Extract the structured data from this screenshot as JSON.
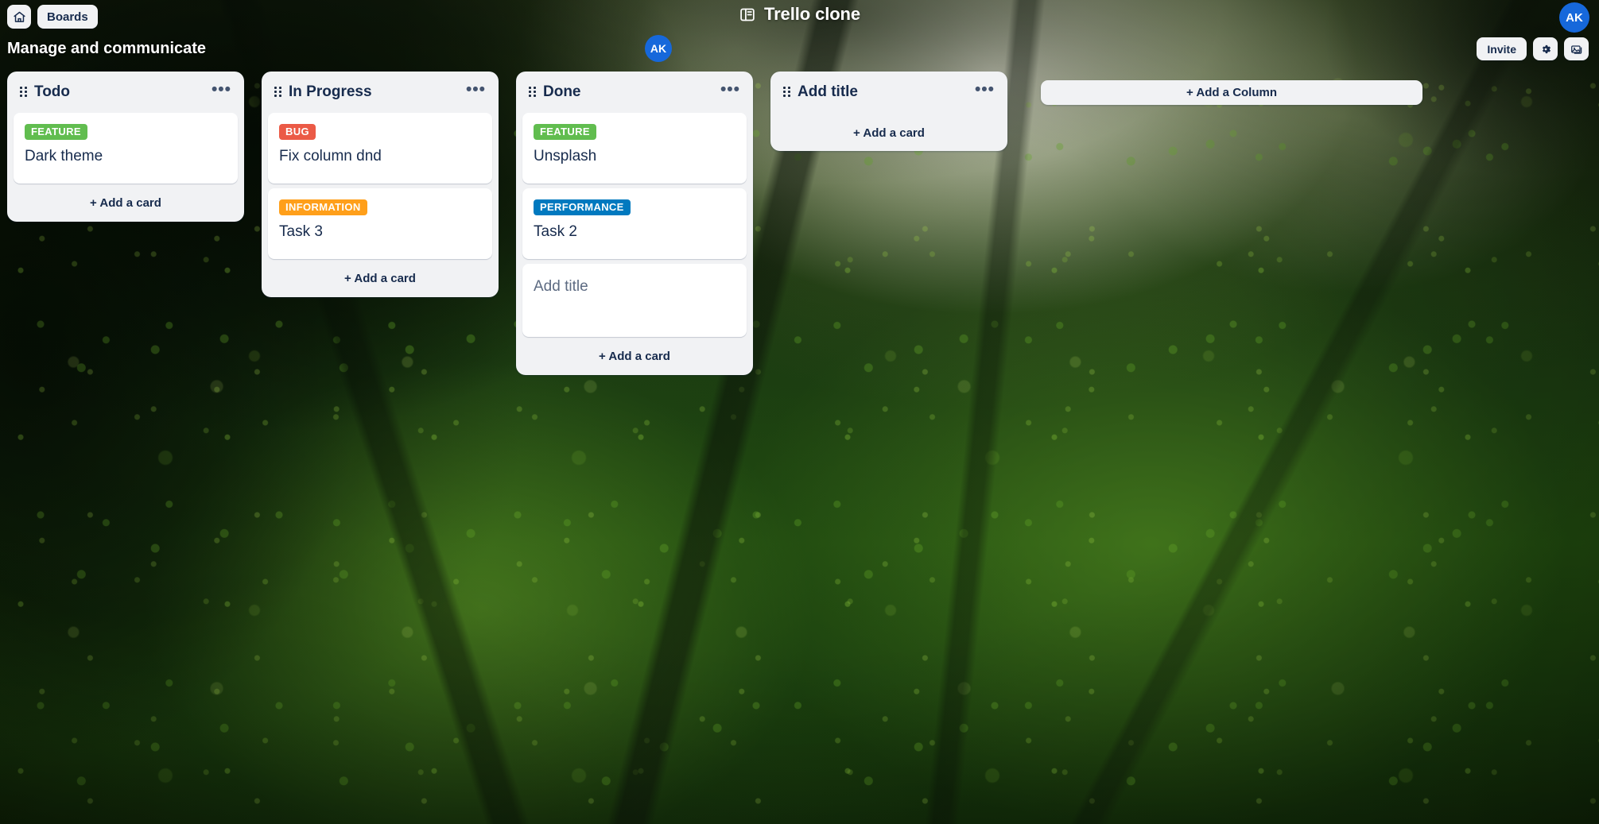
{
  "header": {
    "home_icon": "home-icon",
    "boards_label": "Boards",
    "board_glyph": "board-icon",
    "app_title": "Trello clone",
    "user_initials": "AK"
  },
  "board": {
    "subtitle": "Manage and communicate",
    "member_initials": "AK",
    "invite_label": "Invite",
    "settings_icon": "gear-icon",
    "background_icon": "image-icon",
    "add_column_label": "+ Add a Column",
    "menu_glyph": "•••",
    "add_card_label": "+ Add a card"
  },
  "colors": {
    "feature": "#61bd4f",
    "bug": "#eb5a46",
    "information": "#ff9f1a",
    "performance": "#0079bf",
    "avatar": "#1668db",
    "surface": "#f1f2f4",
    "card": "#ffffff",
    "text": "#172b4d"
  },
  "columns": [
    {
      "title": "Todo",
      "cards": [
        {
          "label": "FEATURE",
          "label_color": "#61bd4f",
          "title": "Dark theme",
          "placeholder": false
        }
      ]
    },
    {
      "title": "In Progress",
      "cards": [
        {
          "label": "BUG",
          "label_color": "#eb5a46",
          "title": "Fix column dnd",
          "placeholder": false
        },
        {
          "label": "INFORMATION",
          "label_color": "#ff9f1a",
          "title": "Task 3",
          "placeholder": false
        }
      ]
    },
    {
      "title": "Done",
      "cards": [
        {
          "label": "FEATURE",
          "label_color": "#61bd4f",
          "title": "Unsplash",
          "placeholder": false
        },
        {
          "label": "PERFORMANCE",
          "label_color": "#0079bf",
          "title": "Task 2",
          "placeholder": false
        },
        {
          "label": "",
          "label_color": "",
          "title": "Add title",
          "placeholder": true
        }
      ]
    },
    {
      "title": "Add title",
      "cards": []
    }
  ]
}
